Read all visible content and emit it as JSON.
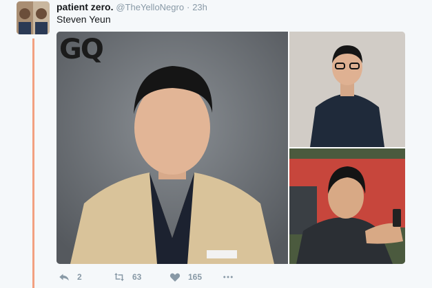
{
  "tweet": {
    "display_name": "patient zero.",
    "handle": "@TheYelloNegro",
    "separator": "·",
    "timestamp": "23h",
    "text": "Steven Yeun"
  },
  "media": {
    "main_overlay_text": "GQ"
  },
  "actions": {
    "reply_count": "2",
    "retweet_count": "63",
    "like_count": "165"
  },
  "icons": {
    "reply": "reply-icon",
    "retweet": "retweet-icon",
    "like": "heart-icon",
    "more": "more-icon"
  },
  "colors": {
    "thread_line": "#f2a080",
    "muted": "#8899a6",
    "background": "#f5f8fa"
  }
}
